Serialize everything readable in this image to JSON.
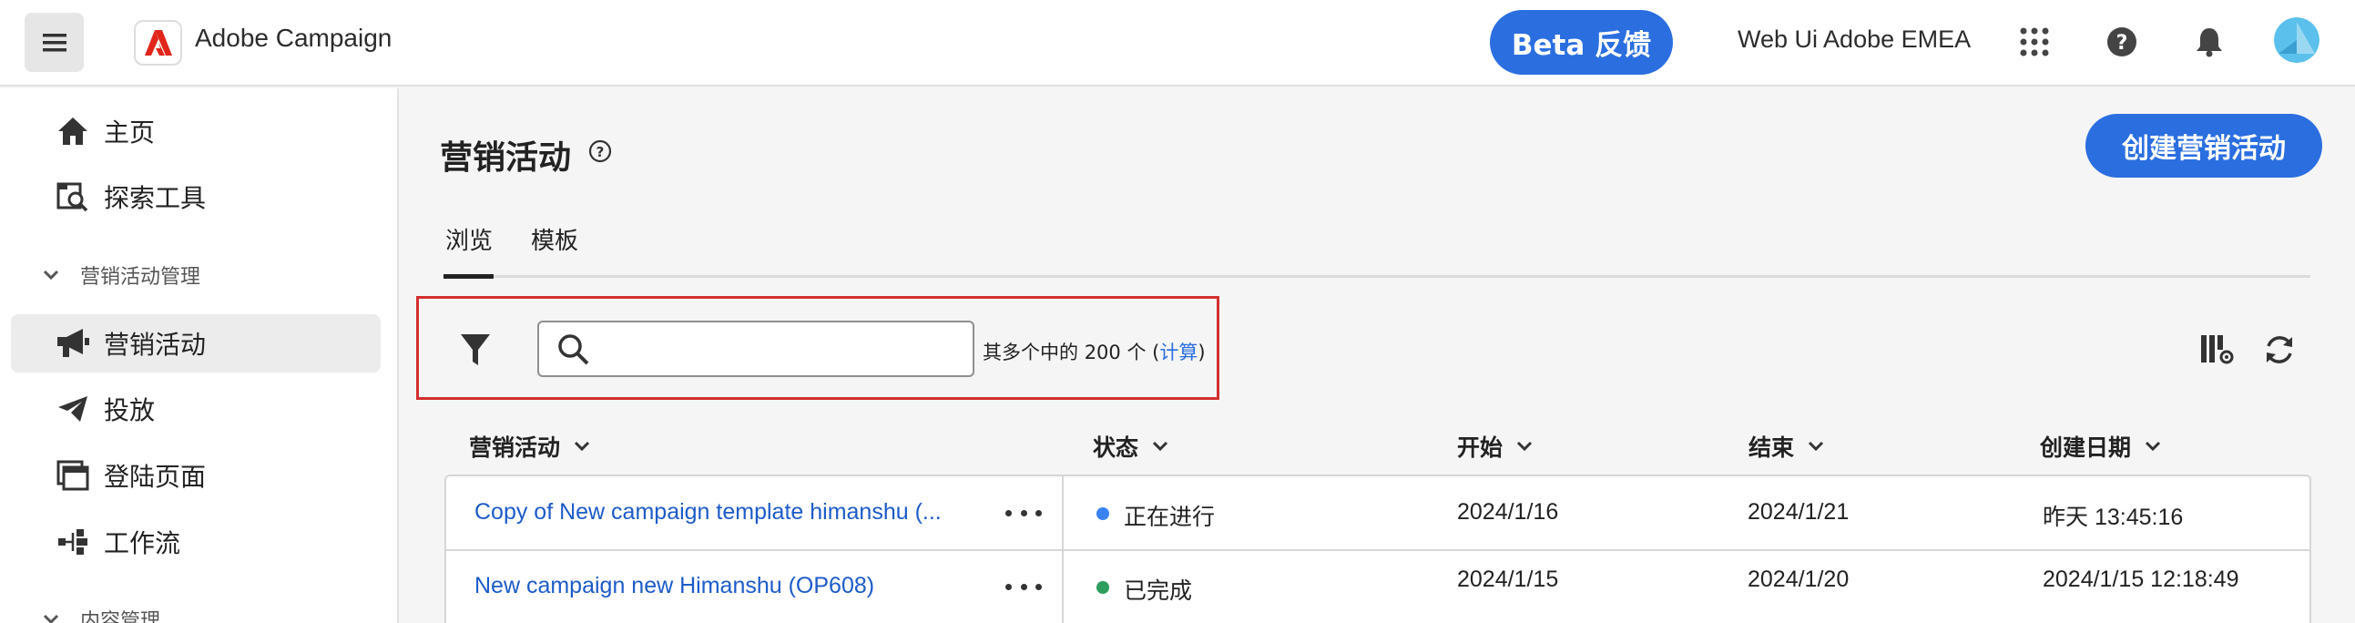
{
  "header": {
    "app_title": "Adobe Campaign",
    "beta_label": "Beta 反馈",
    "org_name": "Web Ui Adobe EMEA"
  },
  "sidebar": {
    "items": [
      {
        "label": "主页",
        "icon": "home-icon"
      },
      {
        "label": "探索工具",
        "icon": "explorer-icon"
      },
      {
        "label": "营销活动管理",
        "icon": "chevron-down-icon",
        "section": true
      },
      {
        "label": "营销活动",
        "icon": "megaphone-icon",
        "active": true
      },
      {
        "label": "投放",
        "icon": "send-icon"
      },
      {
        "label": "登陆页面",
        "icon": "landing-page-icon"
      },
      {
        "label": "工作流",
        "icon": "workflow-icon"
      },
      {
        "label": "内容管理",
        "icon": "chevron-down-icon",
        "section": true
      }
    ]
  },
  "main": {
    "title": "营销活动",
    "create_label": "创建营销活动",
    "tabs": [
      {
        "label": "浏览",
        "active": true
      },
      {
        "label": "模板",
        "active": false
      }
    ],
    "search": {
      "placeholder": "",
      "value": ""
    },
    "count": {
      "prefix": "其多个中的",
      "number": "200",
      "unit": "个",
      "compute_label": "计算"
    },
    "columns": [
      "营销活动",
      "状态",
      "开始",
      "结束",
      "创建日期"
    ],
    "rows": [
      {
        "name": "Copy of New campaign template himanshu (...",
        "status": "正在进行",
        "status_color": "#3b82f6",
        "start": "2024/1/16",
        "end": "2024/1/21",
        "created": "昨天 13:45:16"
      },
      {
        "name": "New campaign new Himanshu (OP608)",
        "status": "已完成",
        "status_color": "#2e9e5e",
        "start": "2024/1/15",
        "end": "2024/1/20",
        "created": "2024/1/15 12:18:49"
      }
    ]
  },
  "colors": {
    "accent": "#2a6ee0",
    "highlight_border": "#d32f2f"
  }
}
